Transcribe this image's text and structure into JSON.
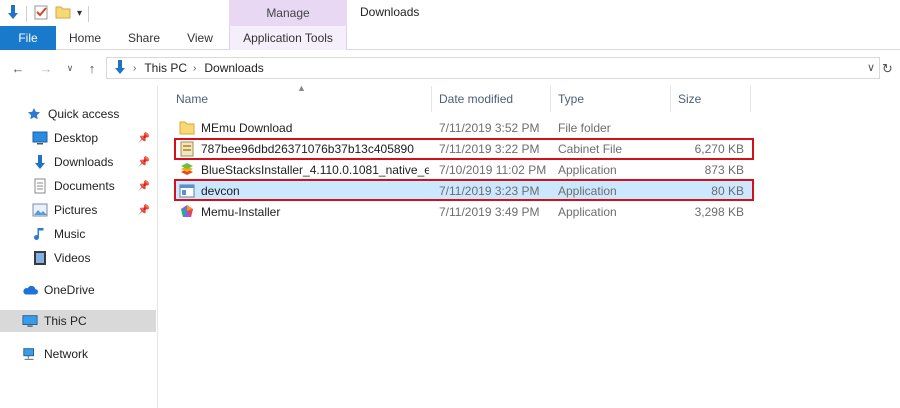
{
  "ribbon": {
    "contextual_group": "Manage",
    "window_title": "Downloads",
    "tabs": {
      "file": "File",
      "home": "Home",
      "share": "Share",
      "view": "View",
      "application_tools": "Application Tools"
    }
  },
  "address": {
    "crumbs": [
      "This PC",
      "Downloads"
    ]
  },
  "navigation": {
    "items": [
      {
        "label": "Quick access",
        "icon": "star-icon"
      },
      {
        "label": "Desktop",
        "icon": "desktop-icon",
        "pinned": true
      },
      {
        "label": "Downloads",
        "icon": "download-arrow-icon",
        "pinned": true
      },
      {
        "label": "Documents",
        "icon": "documents-icon",
        "pinned": true
      },
      {
        "label": "Pictures",
        "icon": "pictures-icon",
        "pinned": true
      },
      {
        "label": "Music",
        "icon": "music-note-icon"
      },
      {
        "label": "Videos",
        "icon": "videos-icon"
      },
      {
        "label": "OneDrive",
        "icon": "cloud-icon"
      },
      {
        "label": "This PC",
        "icon": "computer-icon",
        "selected": true
      },
      {
        "label": "Network",
        "icon": "network-icon"
      }
    ]
  },
  "columns": {
    "name": "Name",
    "date": "Date modified",
    "type": "Type",
    "size": "Size"
  },
  "files": [
    {
      "name": "MEmu Download",
      "date": "7/11/2019 3:52 PM",
      "type": "File folder",
      "size": "",
      "icon": "folder-icon"
    },
    {
      "name": "787bee96dbd26371076b37b13c405890",
      "date": "7/11/2019 3:22 PM",
      "type": "Cabinet File",
      "size": "6,270 KB",
      "icon": "cabinet-file-icon",
      "highlighted": true
    },
    {
      "name": "BlueStacksInstaller_4.110.0.1081_native_e...",
      "date": "7/10/2019 11:02 PM",
      "type": "Application",
      "size": "873 KB",
      "icon": "bluestacks-icon"
    },
    {
      "name": "devcon",
      "date": "7/11/2019 3:23 PM",
      "type": "Application",
      "size": "80 KB",
      "icon": "application-icon",
      "selected": true,
      "highlighted": true
    },
    {
      "name": "Memu-Installer",
      "date": "7/11/2019 3:49 PM",
      "type": "Application",
      "size": "3,298 KB",
      "icon": "memu-icon"
    }
  ],
  "colors": {
    "file_tab": "#1979ca",
    "manage_context": "#e8d8f3",
    "selection": "#cce8ff",
    "nav_selected": "#d9d9d9",
    "highlight_box": "#d4101a"
  }
}
